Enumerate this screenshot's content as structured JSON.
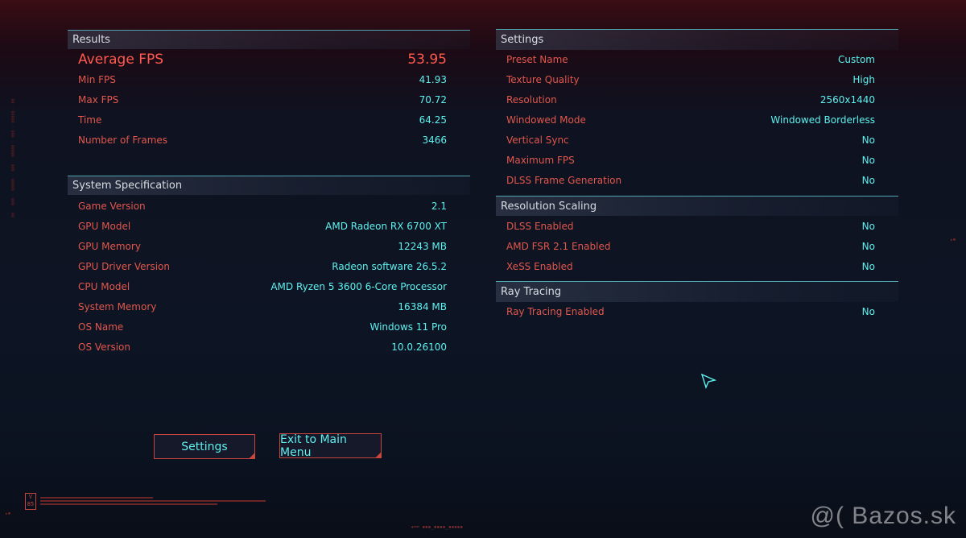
{
  "results": {
    "header": "Results",
    "average_fps": {
      "label": "Average FPS",
      "value": "53.95"
    },
    "rows": [
      {
        "label": "Min FPS",
        "value": "41.93"
      },
      {
        "label": "Max FPS",
        "value": "70.72"
      },
      {
        "label": "Time",
        "value": "64.25"
      },
      {
        "label": "Number of Frames",
        "value": "3466"
      }
    ]
  },
  "system": {
    "header": "System Specification",
    "rows": [
      {
        "label": "Game Version",
        "value": "2.1"
      },
      {
        "label": "GPU Model",
        "value": "AMD Radeon RX 6700 XT"
      },
      {
        "label": "GPU Memory",
        "value": "12243 MB"
      },
      {
        "label": "GPU Driver Version",
        "value": "Radeon software 26.5.2"
      },
      {
        "label": "CPU Model",
        "value": "AMD Ryzen 5 3600 6-Core Processor"
      },
      {
        "label": "System Memory",
        "value": "16384 MB"
      },
      {
        "label": "OS Name",
        "value": "Windows 11 Pro"
      },
      {
        "label": "OS Version",
        "value": "10.0.26100"
      }
    ]
  },
  "settings": {
    "header": "Settings",
    "rows": [
      {
        "label": "Preset Name",
        "value": "Custom"
      },
      {
        "label": "Texture Quality",
        "value": "High"
      },
      {
        "label": "Resolution",
        "value": "2560x1440"
      },
      {
        "label": "Windowed Mode",
        "value": "Windowed Borderless"
      },
      {
        "label": "Vertical Sync",
        "value": "No"
      },
      {
        "label": "Maximum FPS",
        "value": "No"
      },
      {
        "label": "DLSS Frame Generation",
        "value": "No"
      }
    ]
  },
  "resolution_scaling": {
    "header": "Resolution Scaling",
    "rows": [
      {
        "label": "DLSS Enabled",
        "value": "No"
      },
      {
        "label": "AMD FSR 2.1 Enabled",
        "value": "No"
      },
      {
        "label": "XeSS Enabled",
        "value": "No"
      }
    ]
  },
  "ray_tracing": {
    "header": "Ray Tracing",
    "rows": [
      {
        "label": "Ray Tracing Enabled",
        "value": "No"
      }
    ]
  },
  "buttons": {
    "settings_label": "Settings",
    "exit_label": "Exit to Main Menu"
  },
  "watermark": "@( Bazos.sk",
  "version_badge": "V 85",
  "colors": {
    "label": "#e2574c",
    "value": "#5ef1ef",
    "accent_line": "#52a3b0",
    "button_border": "#c8463c"
  }
}
